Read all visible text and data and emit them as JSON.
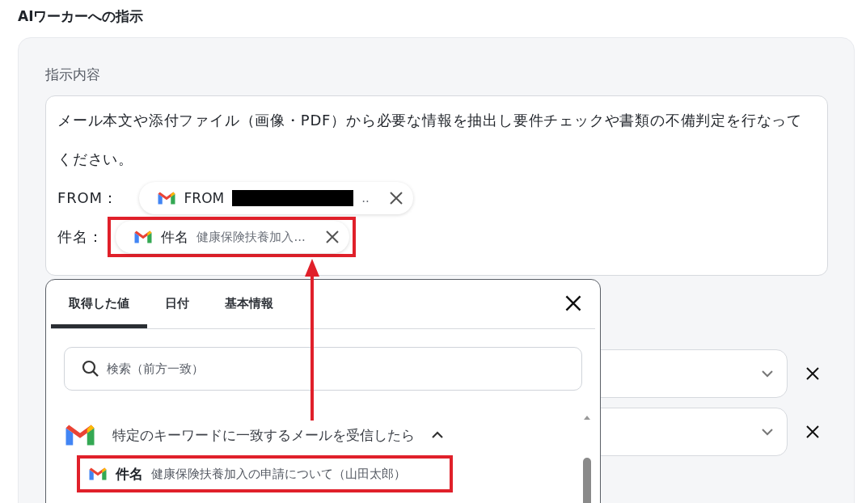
{
  "section_title": "AIワーカーへの指示",
  "instruction": {
    "label": "指示内容",
    "text": "メール本文や添付ファイル（画像・PDF）から必要な情報を抽出し要件チェックや書類の不備判定を行なってください。",
    "variables": [
      {
        "label": "FROM：",
        "name": "FROM",
        "redacted": true,
        "value": "..",
        "highlighted": false
      },
      {
        "label": "件名：",
        "name": "件名",
        "redacted": false,
        "value": "健康保険扶養加入...",
        "highlighted": true
      }
    ]
  },
  "select_rows": [
    {
      "kind": "select"
    },
    {
      "kind": "select"
    }
  ],
  "popup": {
    "tabs": [
      {
        "label": "取得した値",
        "selected": true
      },
      {
        "label": "日付",
        "selected": false
      },
      {
        "label": "基本情報",
        "selected": false
      }
    ],
    "search": {
      "placeholder": "検索（前方一致）"
    },
    "group": {
      "title": "特定のキーワードに一致するメールを受信したら",
      "expanded": true,
      "items": [
        {
          "name": "件名",
          "value": "健康保険扶養加入の申請について（山田太郎）",
          "highlighted": true
        }
      ]
    }
  }
}
